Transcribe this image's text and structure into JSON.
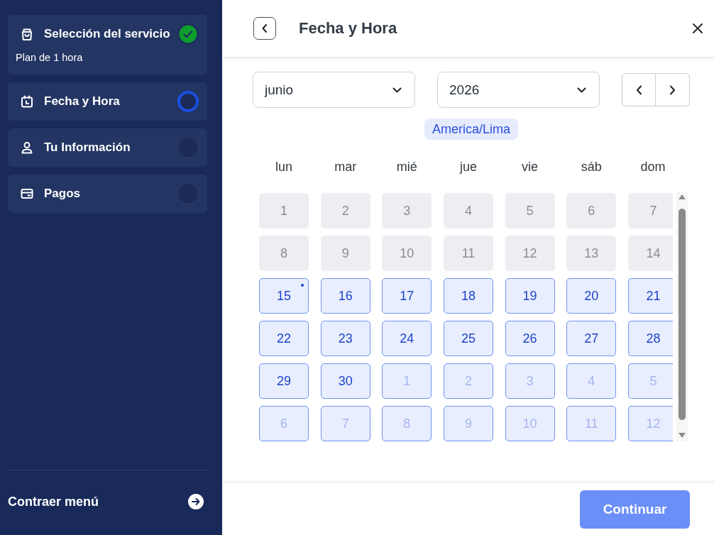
{
  "sidebar": {
    "steps": [
      {
        "label": "Selección del servicio",
        "detail": "Plan de 1 hora",
        "completed": true,
        "selected": false
      },
      {
        "label": "Fecha y Hora",
        "completed": false,
        "selected": true
      },
      {
        "label": "Tu Información",
        "completed": false,
        "selected": false
      },
      {
        "label": "Pagos",
        "completed": false,
        "selected": false
      }
    ],
    "collapse_label": "Contraer menú"
  },
  "header": {
    "title": "Fecha y Hora"
  },
  "month_select": {
    "value": "junio"
  },
  "year_select": {
    "value": "2026"
  },
  "timezone": "America/Lima",
  "calendar": {
    "weekdays": [
      "lun",
      "mar",
      "mié",
      "jue",
      "vie",
      "sáb",
      "dom"
    ],
    "weeks": [
      [
        {
          "day": "1",
          "kind": "past",
          "today": false
        },
        {
          "day": "2",
          "kind": "past",
          "today": false
        },
        {
          "day": "3",
          "kind": "past",
          "today": false
        },
        {
          "day": "4",
          "kind": "past",
          "today": false
        },
        {
          "day": "5",
          "kind": "past",
          "today": false
        },
        {
          "day": "6",
          "kind": "past",
          "today": false
        },
        {
          "day": "7",
          "kind": "past",
          "today": false
        }
      ],
      [
        {
          "day": "8",
          "kind": "past",
          "today": false
        },
        {
          "day": "9",
          "kind": "past",
          "today": false
        },
        {
          "day": "10",
          "kind": "past",
          "today": false
        },
        {
          "day": "11",
          "kind": "past",
          "today": false
        },
        {
          "day": "12",
          "kind": "past",
          "today": false
        },
        {
          "day": "13",
          "kind": "past",
          "today": false
        },
        {
          "day": "14",
          "kind": "past",
          "today": false
        }
      ],
      [
        {
          "day": "15",
          "kind": "available",
          "today": true
        },
        {
          "day": "16",
          "kind": "available",
          "today": false
        },
        {
          "day": "17",
          "kind": "available",
          "today": false
        },
        {
          "day": "18",
          "kind": "available",
          "today": false
        },
        {
          "day": "19",
          "kind": "available",
          "today": false
        },
        {
          "day": "20",
          "kind": "available",
          "today": false
        },
        {
          "day": "21",
          "kind": "available",
          "today": false
        }
      ],
      [
        {
          "day": "22",
          "kind": "available",
          "today": false
        },
        {
          "day": "23",
          "kind": "available",
          "today": false
        },
        {
          "day": "24",
          "kind": "available",
          "today": false
        },
        {
          "day": "25",
          "kind": "available",
          "today": false
        },
        {
          "day": "26",
          "kind": "available",
          "today": false
        },
        {
          "day": "27",
          "kind": "available",
          "today": false
        },
        {
          "day": "28",
          "kind": "available",
          "today": false
        }
      ],
      [
        {
          "day": "29",
          "kind": "available",
          "today": false
        },
        {
          "day": "30",
          "kind": "available",
          "today": false
        },
        {
          "day": "1",
          "kind": "outside",
          "today": false
        },
        {
          "day": "2",
          "kind": "outside",
          "today": false
        },
        {
          "day": "3",
          "kind": "outside",
          "today": false
        },
        {
          "day": "4",
          "kind": "outside",
          "today": false
        },
        {
          "day": "5",
          "kind": "outside",
          "today": false
        }
      ],
      [
        {
          "day": "6",
          "kind": "outside",
          "today": false
        },
        {
          "day": "7",
          "kind": "outside",
          "today": false
        },
        {
          "day": "8",
          "kind": "outside",
          "today": false
        },
        {
          "day": "9",
          "kind": "outside",
          "today": false
        },
        {
          "day": "10",
          "kind": "outside",
          "today": false
        },
        {
          "day": "11",
          "kind": "outside",
          "today": false
        },
        {
          "day": "12",
          "kind": "outside",
          "today": false
        }
      ]
    ]
  },
  "footer": {
    "continue_button": {
      "label": "Continuar",
      "disabled": true
    }
  }
}
